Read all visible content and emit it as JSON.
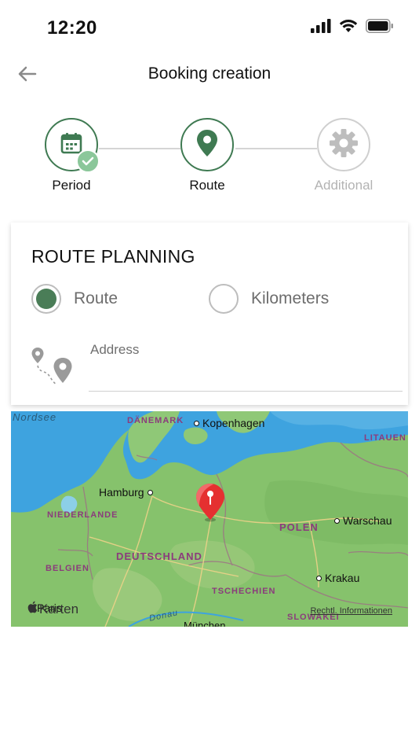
{
  "status_bar": {
    "time": "12:20"
  },
  "nav": {
    "title": "Booking creation"
  },
  "stepper": {
    "steps": [
      {
        "label": "Period",
        "state": "done"
      },
      {
        "label": "Route",
        "state": "active"
      },
      {
        "label": "Additional",
        "state": "inactive"
      }
    ]
  },
  "route_planning": {
    "title": "ROUTE PLANNING",
    "options": [
      {
        "label": "Route",
        "selected": true
      },
      {
        "label": "Kilometers",
        "selected": false
      }
    ],
    "address": {
      "label": "Address",
      "value": ""
    }
  },
  "map": {
    "sea_labels": [
      "Nordsee"
    ],
    "countries": [
      "DÄNEMARK",
      "LITAUEN",
      "NIEDERLANDE",
      "POLEN",
      "DEUTSCHLAND",
      "BELGIEN",
      "TSCHECHIEN",
      "SLOWAKEI"
    ],
    "cities": [
      "Kopenhagen",
      "Hamburg",
      "Warschau",
      "Krakau",
      "Paris",
      "München"
    ],
    "river": "Donau",
    "brand": "Karten",
    "legal": "Rechtl. Informationen"
  },
  "colors": {
    "accent": "#3f7a52",
    "check": "#8bc79a",
    "pin": "#e53030",
    "land": "#86c26c",
    "water": "#3ea3df"
  }
}
